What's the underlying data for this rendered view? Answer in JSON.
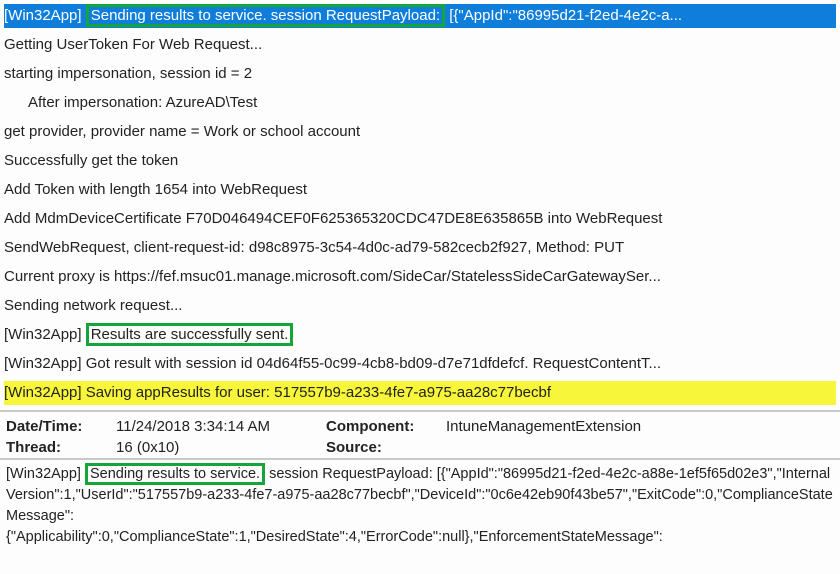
{
  "log": {
    "l0_tag": "[Win32App]",
    "l0_box": "Sending results to service. session RequestPayload:",
    "l0_rest": " [{\"AppId\":\"86995d21-f2ed-4e2c-a...",
    "l1": "Getting UserToken For Web Request...",
    "l2": "starting impersonation, session id = 2",
    "l3": "After impersonation: AzureAD\\Test",
    "l4": "get provider, provider name = Work or school account",
    "l5": "Successfully get the token",
    "l6": "Add Token with length 1654 into WebRequest",
    "l7": "Add MdmDeviceCertificate F70D046494CEF0F625365320CDC47DE8E635865B into WebRequest",
    "l8": "SendWebRequest, client-request-id: d98c8975-3c54-4d0c-ad79-582cecb2f927, Method: PUT",
    "l9": "Current proxy is https://fef.msuc01.manage.microsoft.com/SideCar/StatelessSideCarGatewaySer...",
    "l10": "Sending network request...",
    "l11_tag": "[Win32App]",
    "l11_box": "Results are successfully sent.",
    "l12": "[Win32App] Got result with session id 04d64f55-0c99-4cb8-bd09-d7e71dfdefcf. RequestContentT...",
    "l13": "[Win32App] Saving appResults for user: 517557b9-a233-4fe7-a975-aa28c77becbf"
  },
  "meta": {
    "datetime_label": "Date/Time:",
    "datetime_value": "11/24/2018 3:34:14 AM",
    "component_label": "Component:",
    "component_value": "IntuneManagementExtension",
    "thread_label": "Thread:",
    "thread_value": "16 (0x10)",
    "source_label": "Source:",
    "source_value": ""
  },
  "detail": {
    "pre_tag": "[Win32App] ",
    "box": "Sending results to service.",
    "line1_rest": " session RequestPayload: [{\"AppId\":\"86995d21-f2ed-4e2c-a88e-1ef5f65d02e3\",\"InternalVersion\":1,\"UserId\":\"517557b9-a233-4fe7-a975-aa28c77becbf\",\"DeviceId\":\"0c6e42eb90f43be57\",\"ExitCode\":0,\"ComplianceStateMessage\":",
    "line2": "{\"Applicability\":0,\"ComplianceState\":1,\"DesiredState\":4,\"ErrorCode\":null},\"EnforcementStateMessage\":"
  }
}
